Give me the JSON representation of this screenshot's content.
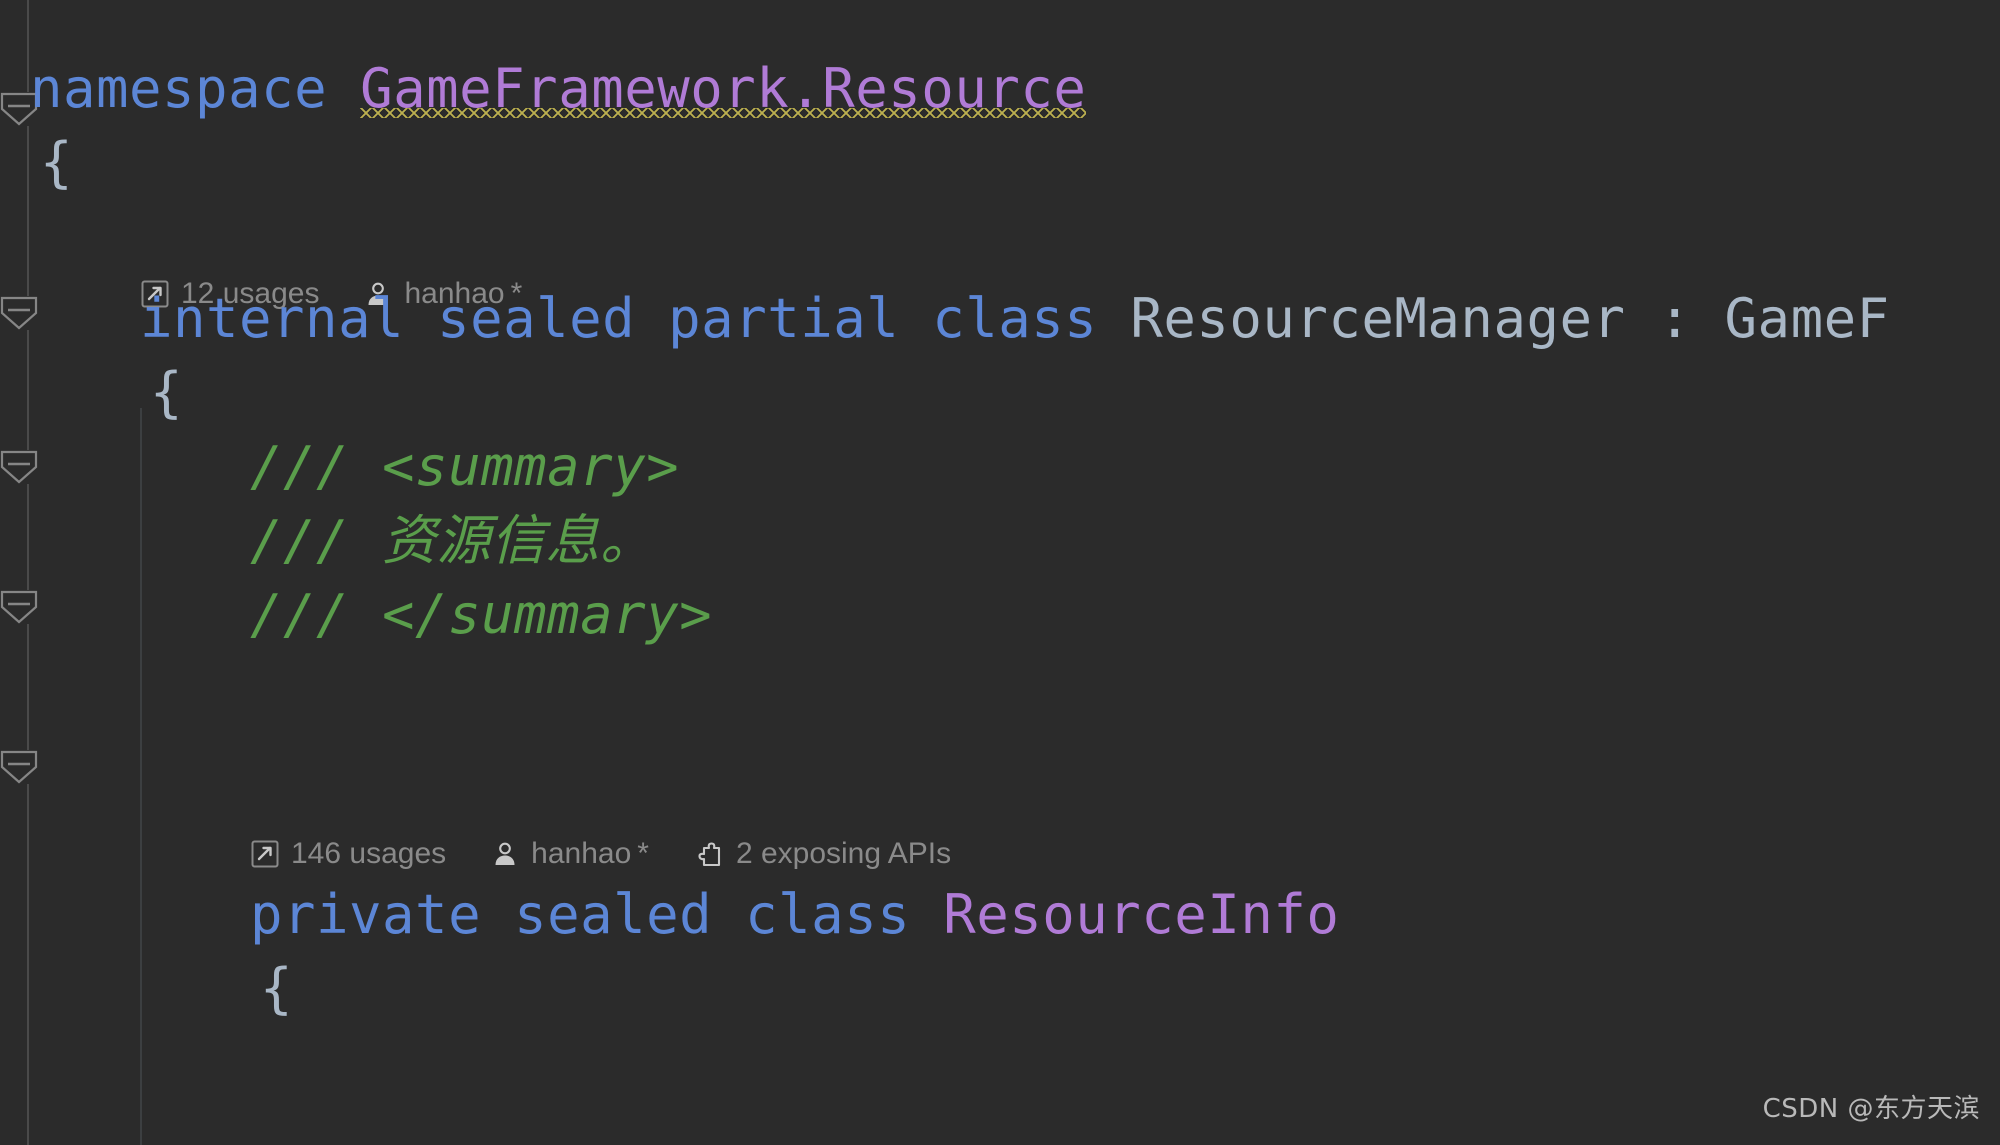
{
  "editor": {
    "theme": "darcula",
    "background_color": "#2b2b2b",
    "gutter_color": "#2b2b2b",
    "language": "C#"
  },
  "colors": {
    "keyword": "#5c86d6",
    "type_identifier": "#a9b7c6",
    "class_identifier": "#b07bd6",
    "doc_comment": "#5a9e4b",
    "punctuation": "#a9b7c6",
    "inlay_hint": "#8a8a8a",
    "warning_squiggle": "#bcb04f",
    "fold_marker": "#868686",
    "indent_guide": "#3c3f41"
  },
  "code": {
    "line1": {
      "keyword": "namespace",
      "space": " ",
      "namespace_name": "GameFramework.Resource"
    },
    "line2": {
      "brace": "{"
    },
    "line3_hint": {
      "usages_icon": "usages-arrow-icon",
      "usages": "12 usages",
      "author_icon": "author-person-icon",
      "author": "hanhao",
      "modified_marker": "*"
    },
    "line4": {
      "modifiers": "internal sealed partial class ",
      "class_name": "ResourceManager",
      "colon": " : ",
      "base_type_truncated": "GameF"
    },
    "line5": {
      "brace": "{"
    },
    "line6": {
      "doc": "/// <summary>"
    },
    "line7": {
      "doc_slashes": "/// ",
      "doc_text": "资源信息。"
    },
    "line8": {
      "doc": "/// </summary>"
    },
    "line9_hint": {
      "usages_icon": "usages-arrow-icon",
      "usages": "146 usages",
      "author_icon": "author-person-icon",
      "author": "hanhao",
      "modified_marker": "*",
      "apis_icon": "exposing-apis-puzzle-icon",
      "apis": "2 exposing APIs"
    },
    "line10": {
      "modifiers": "private sealed class ",
      "class_name": "ResourceInfo"
    },
    "line11": {
      "brace": "{"
    }
  },
  "gutter": {
    "fold_markers": [
      {
        "name": "fold-marker-namespace",
        "state": "expanded"
      },
      {
        "name": "fold-marker-class-resourcemanager",
        "state": "expanded"
      },
      {
        "name": "fold-marker-doc-comment",
        "state": "expanded"
      },
      {
        "name": "fold-marker-class-resourceinfo",
        "state": "expanded"
      },
      {
        "name": "fold-marker-member",
        "state": "expanded"
      }
    ]
  },
  "watermark": {
    "text": "CSDN @东方天滨"
  }
}
